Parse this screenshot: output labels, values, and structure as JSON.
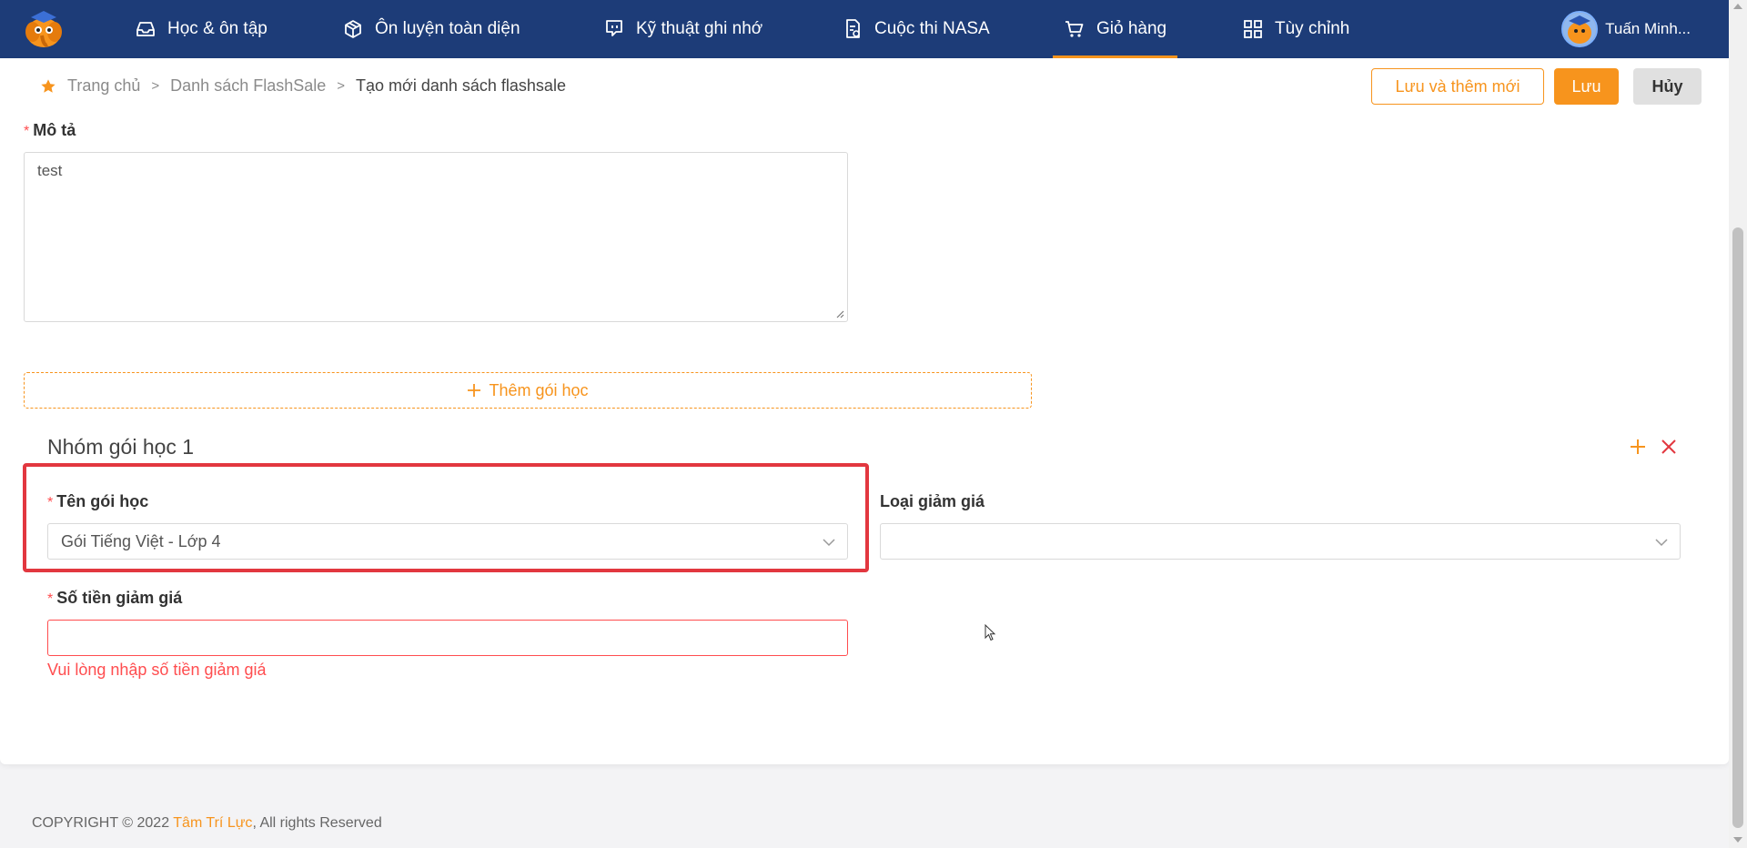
{
  "nav": {
    "items": [
      {
        "label": "Học & ôn tập",
        "icon": "inbox-icon"
      },
      {
        "label": "Ôn luyện toàn diện",
        "icon": "box-icon"
      },
      {
        "label": "Kỹ thuật ghi nhớ",
        "icon": "chat-icon"
      },
      {
        "label": "Cuộc thi NASA",
        "icon": "document-icon"
      },
      {
        "label": "Giỏ hàng",
        "icon": "cart-icon",
        "active": true
      },
      {
        "label": "Tùy chỉnh",
        "icon": "grid-icon"
      }
    ],
    "user_name": "Tuấn Minh..."
  },
  "breadcrumb": {
    "home": "Trang chủ",
    "list": "Danh sách FlashSale",
    "current": "Tạo mới danh sách flashsale",
    "separator": ">"
  },
  "actions": {
    "save_and_new": "Lưu và thêm mới",
    "save": "Lưu",
    "cancel": "Hủy"
  },
  "form": {
    "description_label": "Mô tả",
    "description_value": "test",
    "add_package_label": "Thêm gói học",
    "group_title": "Nhóm gói học 1",
    "package_name_label": "Tên gói học",
    "package_name_value": "Gói Tiếng Việt - Lớp 4",
    "discount_type_label": "Loại giảm giá",
    "discount_type_value": "",
    "discount_amount_label": "Số tiền giảm giá",
    "discount_amount_value": "",
    "discount_amount_error": "Vui lòng nhập số tiền giảm giá",
    "required_mark": "*"
  },
  "footer": {
    "prefix": "COPYRIGHT © 2022 ",
    "brand": "Tâm Trí Lực",
    "suffix": ", All rights Reserved"
  },
  "colors": {
    "nav_bg": "#1d3c78",
    "accent": "#f7941d",
    "error": "#ff4d4f",
    "highlight": "#e2373f"
  }
}
